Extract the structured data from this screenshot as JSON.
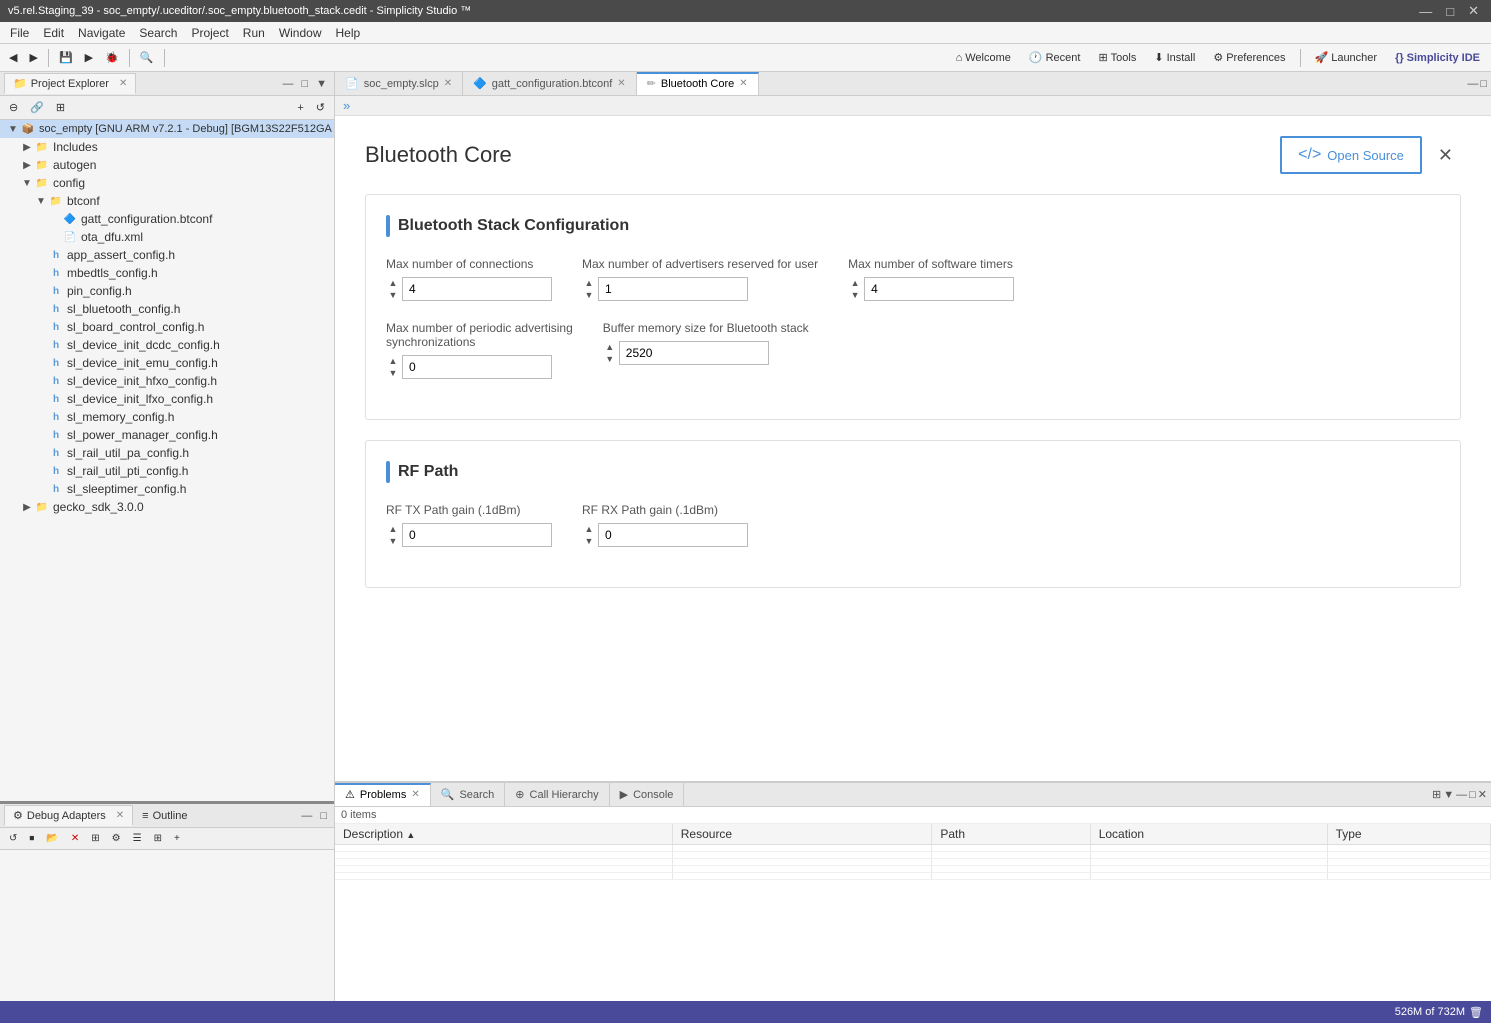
{
  "window": {
    "title": "v5.rel.Staging_39 - soc_empty/.uceditor/.soc_empty.bluetooth_stack.cedit - Simplicity Studio ™"
  },
  "title_bar": {
    "controls": [
      "—",
      "□",
      "✕"
    ]
  },
  "menu": {
    "items": [
      "File",
      "Edit",
      "Navigate",
      "Search",
      "Project",
      "Run",
      "Window",
      "Help"
    ]
  },
  "toolbar": {
    "items": [
      "◀",
      "▶",
      "⬛",
      "🔽"
    ],
    "welcome": "Welcome",
    "recent": "Recent",
    "tools": "Tools",
    "install": "Install",
    "preferences": "Preferences",
    "launcher": "Launcher",
    "simplicity_ide": "Simplicity IDE"
  },
  "project_explorer": {
    "tab_label": "Project Explorer",
    "project_name": "soc_empty [GNU ARM v7.2.1 - Debug] [BGM13S22F512GA",
    "tree": [
      {
        "id": "includes",
        "label": "Includes",
        "indent": 1,
        "type": "folder",
        "expanded": true
      },
      {
        "id": "autogen",
        "label": "autogen",
        "indent": 1,
        "type": "folder",
        "expanded": false
      },
      {
        "id": "config",
        "label": "config",
        "indent": 1,
        "type": "folder",
        "expanded": true
      },
      {
        "id": "btconf",
        "label": "btconf",
        "indent": 2,
        "type": "folder",
        "expanded": true
      },
      {
        "id": "gatt_conf",
        "label": "gatt_configuration.btconf",
        "indent": 3,
        "type": "btconf",
        "expanded": false
      },
      {
        "id": "ota_dfu",
        "label": "ota_dfu.xml",
        "indent": 3,
        "type": "xml",
        "expanded": false
      },
      {
        "id": "app_assert",
        "label": "app_assert_config.h",
        "indent": 2,
        "type": "h",
        "expanded": false
      },
      {
        "id": "mbedtls",
        "label": "mbedtls_config.h",
        "indent": 2,
        "type": "h",
        "expanded": false
      },
      {
        "id": "pin_config",
        "label": "pin_config.h",
        "indent": 2,
        "type": "h",
        "expanded": false
      },
      {
        "id": "sl_bluetooth",
        "label": "sl_bluetooth_config.h",
        "indent": 2,
        "type": "h",
        "expanded": false
      },
      {
        "id": "sl_board",
        "label": "sl_board_control_config.h",
        "indent": 2,
        "type": "h",
        "expanded": false
      },
      {
        "id": "sl_device_dcdc",
        "label": "sl_device_init_dcdc_config.h",
        "indent": 2,
        "type": "h",
        "expanded": false
      },
      {
        "id": "sl_device_emu",
        "label": "sl_device_init_emu_config.h",
        "indent": 2,
        "type": "h",
        "expanded": false
      },
      {
        "id": "sl_device_hfxo",
        "label": "sl_device_init_hfxo_config.h",
        "indent": 2,
        "type": "h",
        "expanded": false
      },
      {
        "id": "sl_device_lfxo",
        "label": "sl_device_init_lfxo_config.h",
        "indent": 2,
        "type": "h",
        "expanded": false
      },
      {
        "id": "sl_memory",
        "label": "sl_memory_config.h",
        "indent": 2,
        "type": "h",
        "expanded": false
      },
      {
        "id": "sl_power",
        "label": "sl_power_manager_config.h",
        "indent": 2,
        "type": "h",
        "expanded": false
      },
      {
        "id": "sl_rail_pa",
        "label": "sl_rail_util_pa_config.h",
        "indent": 2,
        "type": "h",
        "expanded": false
      },
      {
        "id": "sl_rail_pti",
        "label": "sl_rail_util_pti_config.h",
        "indent": 2,
        "type": "h",
        "expanded": false
      },
      {
        "id": "sl_sleeptimer",
        "label": "sl_sleeptimer_config.h",
        "indent": 2,
        "type": "h",
        "expanded": false
      },
      {
        "id": "gecko_sdk",
        "label": "gecko_sdk_3.0.0",
        "indent": 1,
        "type": "folder",
        "expanded": false
      }
    ]
  },
  "editor": {
    "tabs": [
      {
        "id": "slcp",
        "label": "soc_empty.slcp",
        "active": false,
        "icon": "slcp"
      },
      {
        "id": "btconf",
        "label": "gatt_configuration.btconf",
        "active": false,
        "icon": "btconf"
      },
      {
        "id": "bluetooth_core",
        "label": "Bluetooth Core",
        "active": true,
        "icon": "cedit",
        "closable": true
      }
    ],
    "breadcrumb": "»"
  },
  "bluetooth_core": {
    "title": "Bluetooth Core",
    "open_source_label": "Open Source",
    "close_label": "✕",
    "sections": [
      {
        "id": "stack_config",
        "title": "Bluetooth Stack Configuration",
        "fields": [
          {
            "id": "max_connections",
            "label": "Max number of connections",
            "value": "4",
            "row": 1,
            "col": 1
          },
          {
            "id": "max_advertisers",
            "label": "Max number of advertisers reserved for user",
            "value": "1",
            "row": 1,
            "col": 2
          },
          {
            "id": "max_timers",
            "label": "Max number of software timers",
            "value": "4",
            "row": 1,
            "col": 3
          },
          {
            "id": "max_periodic_sync",
            "label": "Max number of periodic advertising synchronizations",
            "value": "0",
            "row": 2,
            "col": 1
          },
          {
            "id": "buffer_memory",
            "label": "Buffer memory size for Bluetooth stack",
            "value": "2520",
            "row": 2,
            "col": 2
          }
        ]
      },
      {
        "id": "rf_path",
        "title": "RF Path",
        "fields": [
          {
            "id": "rf_tx_gain",
            "label": "RF TX Path gain (.1dBm)",
            "value": "0"
          },
          {
            "id": "rf_rx_gain",
            "label": "RF RX Path gain (.1dBm)",
            "value": "0"
          }
        ]
      }
    ]
  },
  "bottom_panel": {
    "tabs": [
      {
        "id": "problems",
        "label": "Problems",
        "active": true,
        "closable": true
      },
      {
        "id": "search",
        "label": "Search",
        "active": false,
        "closable": false
      },
      {
        "id": "call_hierarchy",
        "label": "Call Hierarchy",
        "active": false,
        "closable": false
      },
      {
        "id": "console",
        "label": "Console",
        "active": false,
        "closable": false
      }
    ],
    "status": "0 items",
    "table": {
      "columns": [
        "Description",
        "Resource",
        "Path",
        "Location",
        "Type"
      ],
      "rows": []
    }
  },
  "debug_adapters": {
    "tab_label": "Debug Adapters",
    "outline_tab_label": "Outline"
  },
  "status_bar": {
    "memory": "526M of 732M"
  }
}
